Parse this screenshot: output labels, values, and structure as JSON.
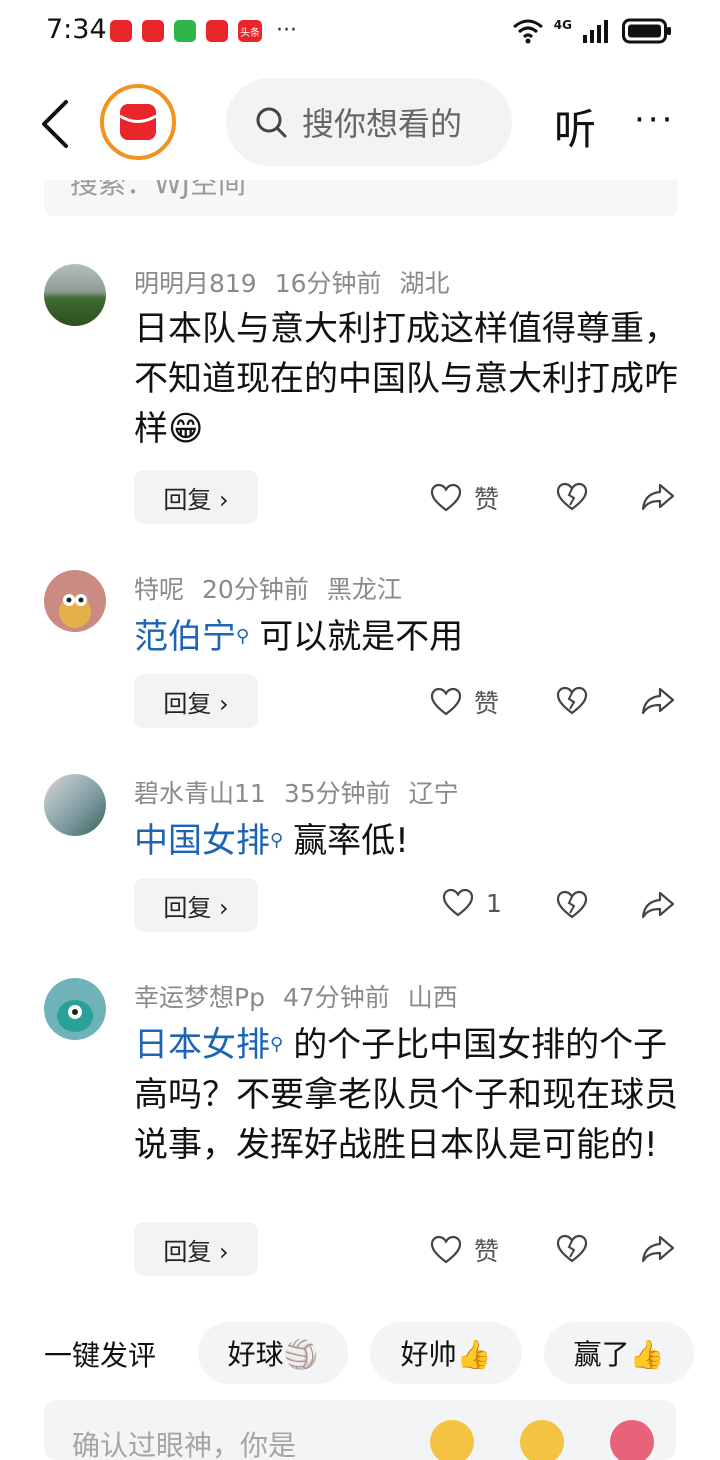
{
  "status": {
    "time": "7:34",
    "network": "4G",
    "notif_icons": [
      "huawei-store",
      "huawei-store",
      "wechat",
      "reader",
      "toutiao"
    ],
    "toutiao_label": "头条",
    "more_dots": "···"
  },
  "header": {
    "search_placeholder": "搜你想看的",
    "listen_label": "听",
    "more_label": "···"
  },
  "prev_card_text": "搜索：WJ空间",
  "comments": [
    {
      "user": "明明月819",
      "time": "16分钟前",
      "location": "湖北",
      "text": "日本队与意大利打成这样值得尊重，不知道现在的中国队与意大利打成咋样",
      "emoji": "😁",
      "reply_label": "回复 ›",
      "like_label": "赞",
      "avatar_color": "#5b7a4a"
    },
    {
      "user": "特呢",
      "time": "20分钟前",
      "location": "黑龙江",
      "link": "范伯宁",
      "text": "可以就是不用",
      "reply_label": "回复 ›",
      "like_label": "赞",
      "avatar_color": "#c9847a"
    },
    {
      "user": "碧水青山11",
      "time": "35分钟前",
      "location": "辽宁",
      "link": "中国女排",
      "text": "赢率低!",
      "reply_label": "回复 ›",
      "like_label": "1",
      "avatar_color": "#8fa8a0"
    },
    {
      "user": "幸运梦想Pp",
      "time": "47分钟前",
      "location": "山西",
      "link": "日本女排",
      "text": "的个子比中国女排的个子高吗？不要拿老队员个子和现在球员说事，发挥好战胜日本队是可能的!",
      "reply_label": "回复 ›",
      "like_label": "赞",
      "avatar_color": "#6fb3b9"
    }
  ],
  "quick_reply": {
    "label": "一键发评",
    "chips": [
      "好球🏐",
      "好帅👍",
      "赢了👍"
    ]
  },
  "input": {
    "placeholder": "确认过眼神，你是"
  },
  "colors": {
    "link": "#1e64b4",
    "accent": "#f2931e",
    "logo_red": "#e8262c"
  }
}
